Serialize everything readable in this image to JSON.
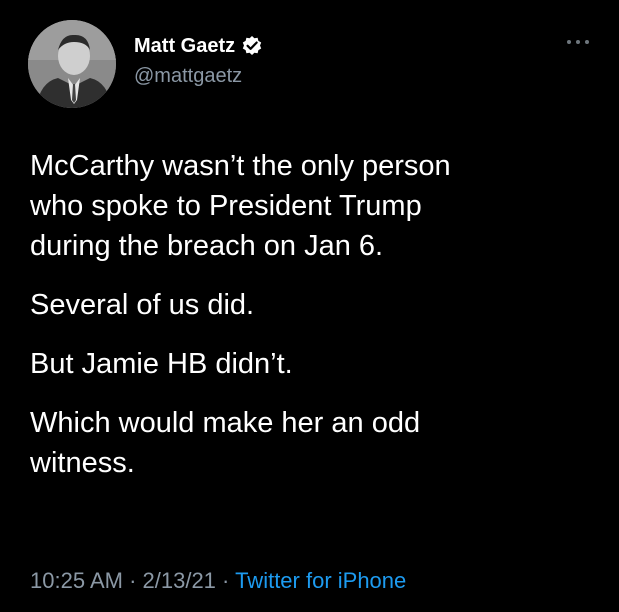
{
  "author": {
    "name": "Matt Gaetz",
    "handle": "@mattgaetz",
    "verified_icon": "verified-badge-icon"
  },
  "menu_icon": "more-options-icon",
  "tweet": {
    "paragraphs": [
      "McCarthy wasn’t the only person\nwho spoke to President Trump\nduring the breach on Jan 6.",
      "Several of us did.",
      "But Jamie HB didn’t.",
      "Which would make her an odd\nwitness."
    ]
  },
  "meta": {
    "time": "10:25 AM",
    "sep1": " · ",
    "date": "2/13/21",
    "sep2": " · ",
    "source": "Twitter for iPhone"
  },
  "colors": {
    "background": "#000000",
    "text": "#ffffff",
    "secondary": "#8b98a5",
    "link": "#1d9bf0"
  }
}
